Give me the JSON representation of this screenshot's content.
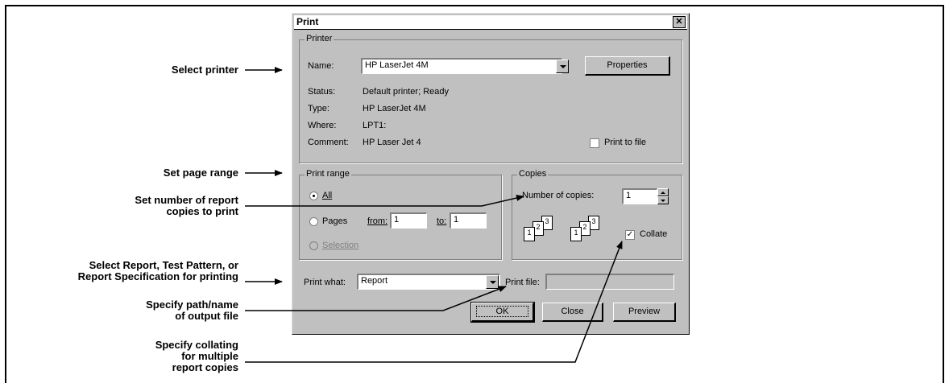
{
  "annotations": {
    "select_printer": "Select printer",
    "set_page_range": "Set page range",
    "set_copies_1": "Set number of report",
    "set_copies_2": "copies to print",
    "select_report_1": "Select Report, Test Pattern, or",
    "select_report_2": "Report Specification for printing",
    "specify_path_1": "Specify path/name",
    "specify_path_2": "of output file",
    "specify_collate_1": "Specify collating",
    "specify_collate_2": "for multiple",
    "specify_collate_3": "report copies"
  },
  "dialog": {
    "title": "Print",
    "close_glyph": "✕",
    "printer": {
      "legend": "Printer",
      "name_label": "Name:",
      "name_value": "HP LaserJet 4M",
      "properties_button": "Properties",
      "status_label": "Status:",
      "status_value": "Default printer; Ready",
      "type_label": "Type:",
      "type_value": "HP LaserJet 4M",
      "where_label": "Where:",
      "where_value": "LPT1:",
      "comment_label": "Comment:",
      "comment_value": "HP Laser Jet 4",
      "print_to_file_label": "Print to file",
      "print_to_file_checked": false
    },
    "print_range": {
      "legend": "Print range",
      "all_label": "All",
      "pages_label": "Pages",
      "from_label": "from:",
      "from_value": "1",
      "to_label": "to:",
      "to_value": "1",
      "selection_label": "Selection",
      "selected": "all"
    },
    "copies": {
      "legend": "Copies",
      "number_label": "Number of copies:",
      "number_value": "1",
      "collate_label": "Collate",
      "collate_checked": true,
      "page_labels": [
        "1",
        "2",
        "3"
      ]
    },
    "print_what_label": "Print what:",
    "print_what_value": "Report",
    "print_file_label": "Print file:",
    "print_file_value": "",
    "ok_button": "OK",
    "close_button": "Close",
    "preview_button": "Preview"
  },
  "colors": {
    "dialog_face": "#c0c0c0",
    "shadow": "#808080",
    "highlight": "#ffffff"
  }
}
